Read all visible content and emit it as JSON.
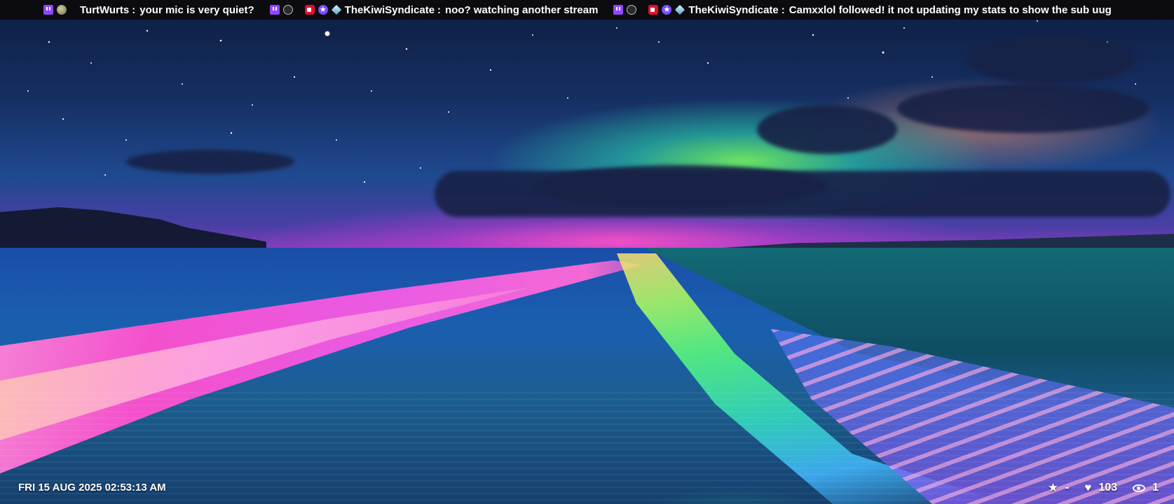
{
  "ticker": {
    "messages": [
      {
        "badges": [
          "twitch-icon",
          "orb-badge-icon"
        ],
        "user": "TurtWurts",
        "separator": ":",
        "text": "your mic is very quiet?"
      },
      {
        "badges": [
          "twitch-icon",
          "shield-badge-icon",
          "camera-badge-icon",
          "star-badge-icon",
          "gem-badge-icon"
        ],
        "user": "TheKiwiSyndicate",
        "separator": ":",
        "text": "noo?  watching another stream"
      },
      {
        "badges": [
          "twitch-icon",
          "shield-badge-icon",
          "camera-badge-icon",
          "star-badge-icon",
          "gem-badge-icon"
        ],
        "user": "TheKiwiSyndicate",
        "separator": ":",
        "text": "Camxxlol followed!  it not updating my stats to show the sub uug"
      }
    ]
  },
  "clock": {
    "datetime": "FRI 15 AUG 2025 02:53:13 AM"
  },
  "stats": {
    "star_value": "-",
    "likes": "103",
    "viewers": "1"
  },
  "colors": {
    "ticker_bg": "#0b0b10",
    "twitch_purple": "#9146ff",
    "text": "#ffffff"
  }
}
